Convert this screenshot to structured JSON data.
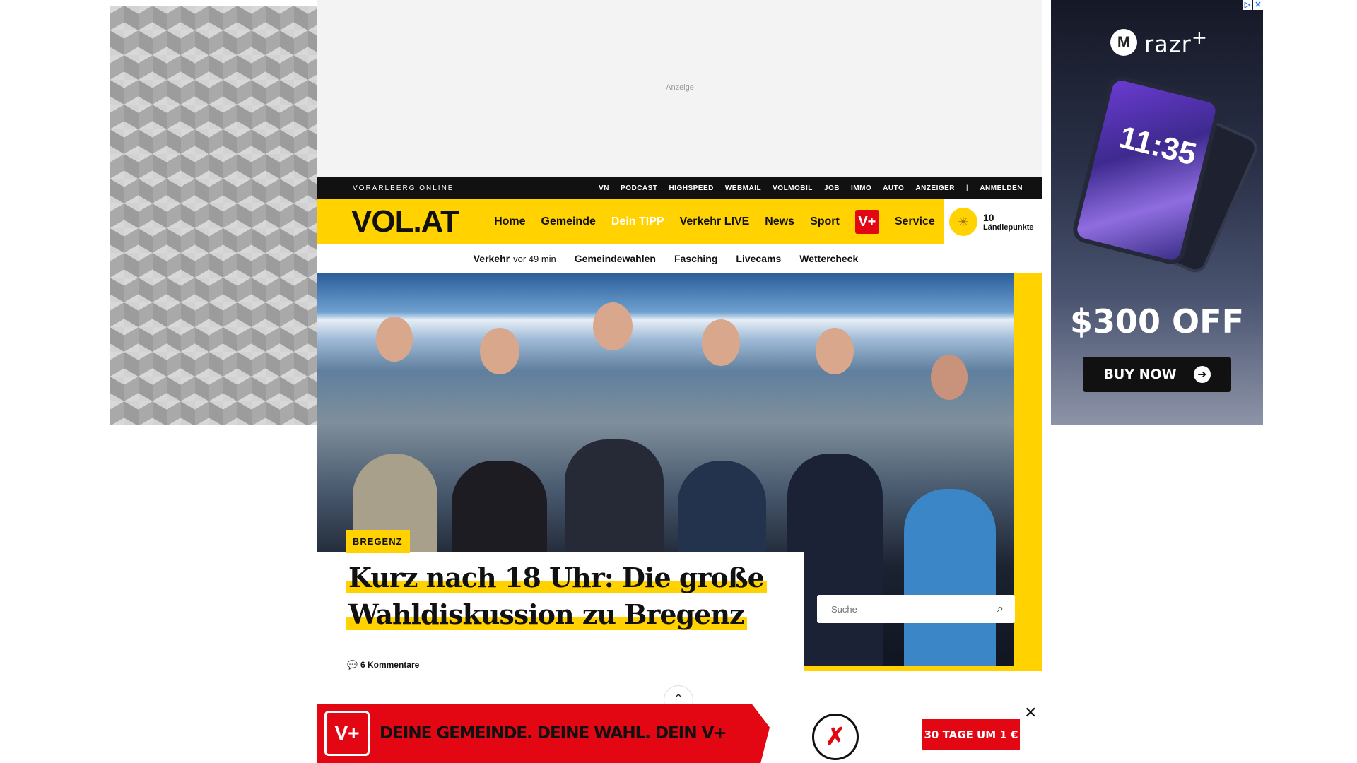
{
  "ad": {
    "top_label": "Anzeige",
    "right": {
      "brand": "razr",
      "brand_sup": "+",
      "time": "11:35",
      "offer": "$300 OFF",
      "button": "BUY NOW",
      "adchoices": [
        "▷",
        "✕"
      ]
    }
  },
  "topbar": {
    "site_name": "VORARLBERG ONLINE",
    "links": [
      "VN",
      "PODCAST",
      "HIGHSPEED",
      "WEBMAIL",
      "VOLMOBIL",
      "JOB",
      "IMMO",
      "AUTO",
      "ANZEIGER"
    ],
    "separator": "|",
    "login": "ANMELDEN"
  },
  "nav": {
    "logo": "VOL.AT",
    "items": [
      "Home",
      "Gemeinde",
      "Dein TIPP",
      "Verkehr LIVE",
      "News",
      "Sport"
    ],
    "vplus": "V+",
    "service": "Service",
    "points_count": "10",
    "points_label": "Ländlepunkte"
  },
  "subnav": {
    "traffic": "Verkehr",
    "traffic_time": "vor 49 min",
    "items": [
      "Gemeindewahlen",
      "Fasching",
      "Livecams",
      "Wettercheck"
    ]
  },
  "hero": {
    "tag": "BREGENZ",
    "headline_line1": "Kurz nach 18 Uhr: Die große",
    "headline_line2": "Wahldiskussion zu Bregenz",
    "comments": "6 Kommentare",
    "search_placeholder": "Suche"
  },
  "banner": {
    "vplus": "V+",
    "slogan": "DEINE GEMEINDE. DEINE WAHL. DEIN V+",
    "cta": "30 TAGE UM 1 €",
    "close": "✕"
  }
}
